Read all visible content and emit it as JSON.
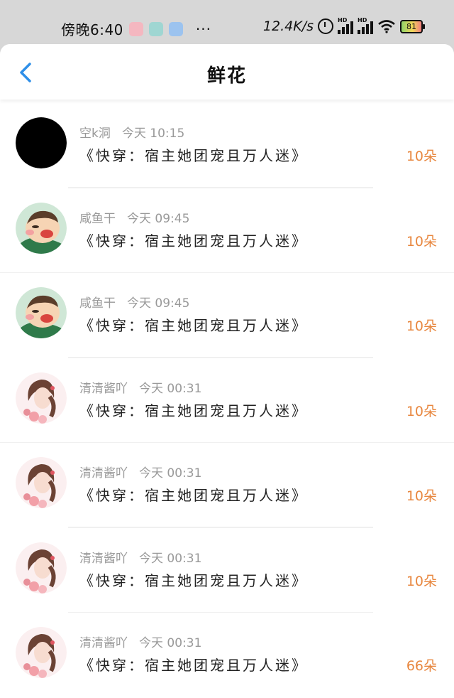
{
  "status_bar": {
    "time": "傍晚6:40",
    "network_speed": "12.4K/s",
    "battery": "81",
    "more": "···",
    "signal_label": "HD",
    "icons": [
      "alarm-icon",
      "signal-icon",
      "signal-icon",
      "wifi-icon",
      "battery-icon"
    ]
  },
  "header": {
    "title": "鲜花",
    "back_icon": "chevron-left-icon"
  },
  "colors": {
    "accent": "#2f8fe8",
    "count": "#e8873f",
    "meta": "#999999"
  },
  "items": [
    {
      "name": "空k洞",
      "time": "今天 10:15",
      "book": "《快穿：宿主她团宠且万人迷》",
      "count": "10朵",
      "avatar": "black-avatar"
    },
    {
      "name": "咸鱼干",
      "time": "今天 09:45",
      "book": "《快穿：宿主她团宠且万人迷》",
      "count": "10朵",
      "avatar": "cartoon-boy-avatar"
    },
    {
      "name": "咸鱼干",
      "time": "今天 09:45",
      "book": "《快穿：宿主她团宠且万人迷》",
      "count": "10朵",
      "avatar": "cartoon-boy-avatar"
    },
    {
      "name": "清清酱吖",
      "time": "今天 00:31",
      "book": "《快穿：宿主她团宠且万人迷》",
      "count": "10朵",
      "avatar": "girl-avatar"
    },
    {
      "name": "清清酱吖",
      "time": "今天 00:31",
      "book": "《快穿：宿主她团宠且万人迷》",
      "count": "10朵",
      "avatar": "girl-avatar"
    },
    {
      "name": "清清酱吖",
      "time": "今天 00:31",
      "book": "《快穿：宿主她团宠且万人迷》",
      "count": "10朵",
      "avatar": "girl-avatar"
    },
    {
      "name": "清清酱吖",
      "time": "今天 00:31",
      "book": "《快穿：宿主她团宠且万人迷》",
      "count": "66朵",
      "avatar": "girl-avatar"
    }
  ]
}
